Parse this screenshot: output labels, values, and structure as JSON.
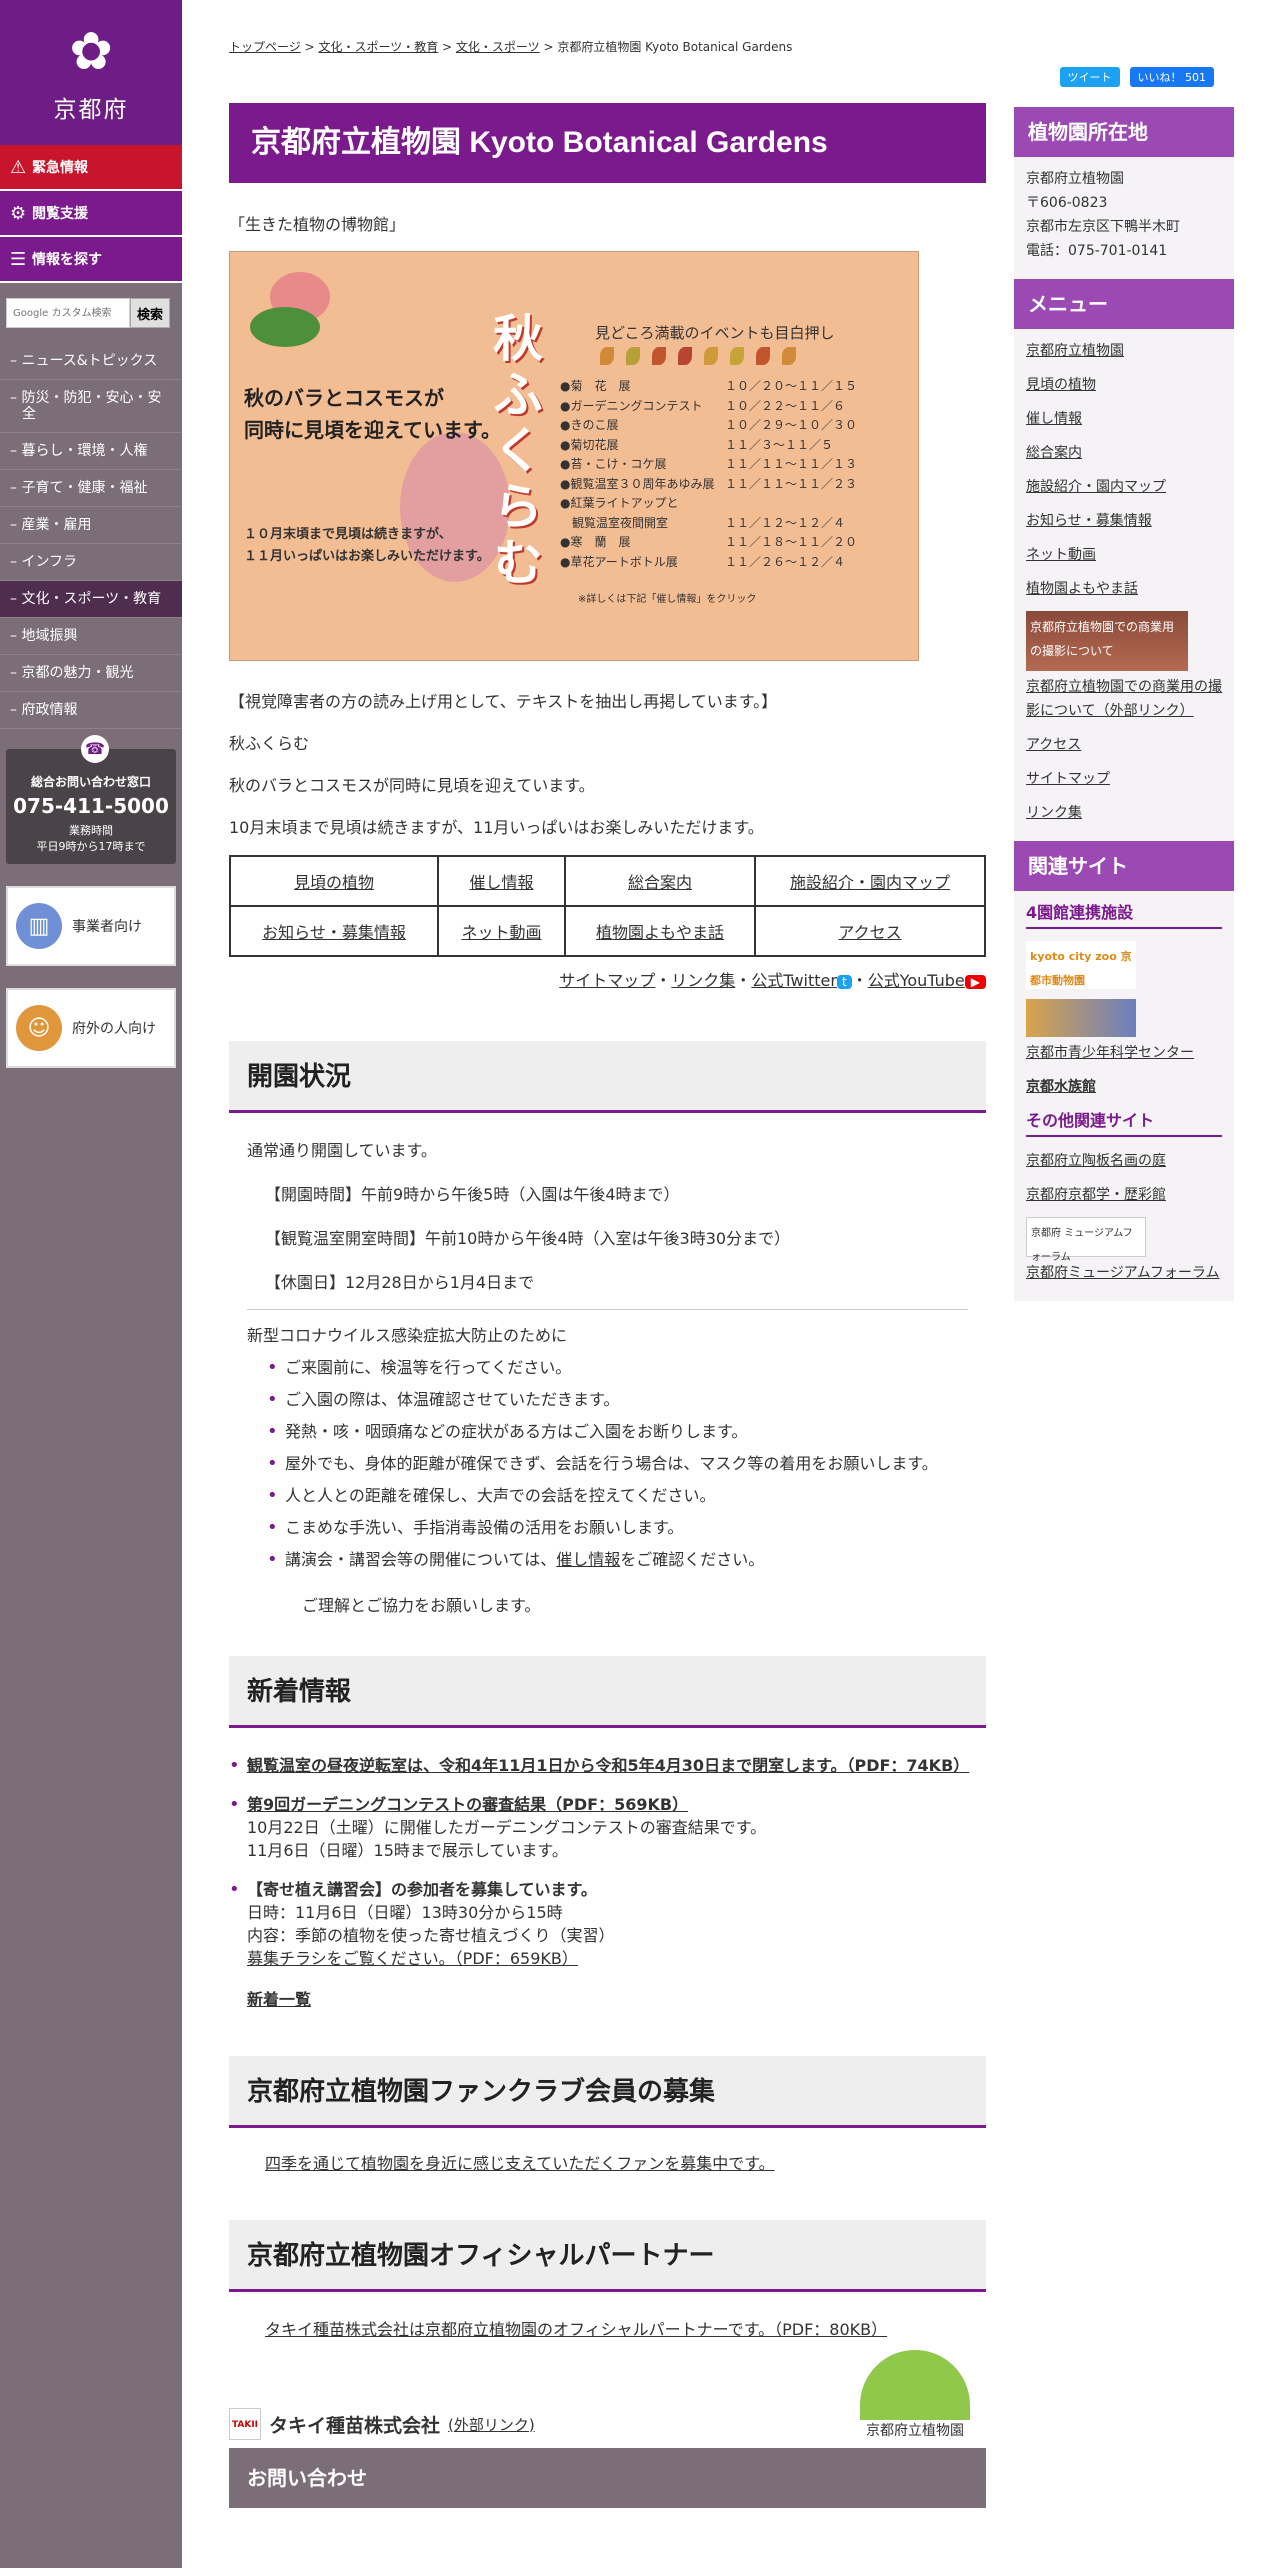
{
  "sidebar": {
    "logo_text": "京都府",
    "emergency": "緊急情報",
    "accessibility": "閲覧支援",
    "find": "情報を探す",
    "search_placeholder": "Google カスタム検索",
    "search_button": "検索",
    "nav": [
      "ニュース&トピックス",
      "防災・防犯・安心・安全",
      "暮らし・環境・人権",
      "子育て・健康・福祉",
      "産業・雇用",
      "インフラ",
      "文化・スポーツ・教育",
      "地域振興",
      "京都の魅力・観光",
      "府政情報"
    ],
    "contact_title": "総合お問い合わせ窓口",
    "contact_phone": "075-411-5000",
    "contact_hours": "業務時間",
    "contact_hours2": "平日9時から17時まで",
    "business": "事業者向け",
    "outside": "府外の人向け"
  },
  "breadcrumb": [
    "トップページ",
    "文化・スポーツ・教育",
    "文化・スポーツ",
    "京都府立植物園 Kyoto Botanical Gardens"
  ],
  "social": {
    "tweet": "ツイート",
    "like": "いいね！ 501"
  },
  "page_title": "京都府立植物園 Kyoto Botanical Gardens",
  "intro": "「生きた植物の博物館」",
  "banner": {
    "main": "秋ふくらむ",
    "left1": "秋のバラとコスモスが",
    "left2": "同時に見頃を迎えています。",
    "small1": "１０月末頃まで見頃は続きますが、",
    "small2": "１１月いっぱいはお楽しみいただけます。",
    "events_title": "見どころ満載のイベントも目白押し",
    "events": [
      {
        "name": "●菊　花　展",
        "date": "１０／２０〜１１／１５"
      },
      {
        "name": "●ガーデニングコンテスト",
        "date": "１０／２２〜１１／６"
      },
      {
        "name": "●きのこ展",
        "date": "１０／２９〜１０／３０"
      },
      {
        "name": "●菊切花展",
        "date": "１１／３〜１１／５"
      },
      {
        "name": "●苔・こけ・コケ展",
        "date": "１１／１１〜１１／１３"
      },
      {
        "name": "●観覧温室３０周年あゆみ展",
        "date": "１１／１１〜１１／２３"
      },
      {
        "name": "●紅葉ライトアップと",
        "date": ""
      },
      {
        "name": "　観覧温室夜間開室",
        "date": "１１／１２〜１２／４"
      },
      {
        "name": "●寒　蘭　展",
        "date": "１１／１８〜１１／２０"
      },
      {
        "name": "●草花アートボトル展",
        "date": "１１／２６〜１２／４"
      }
    ],
    "footnote": "※詳しくは下記「催し情報」をクリック"
  },
  "reader": {
    "note": "【視覚障害者の方の読み上げ用として、テキストを抽出し再掲しています。】",
    "l1": "秋ふくらむ",
    "l2": "秋のバラとコスモスが同時に見頃を迎えています。",
    "l3": "10月末頃まで見頃は続きますが、11月いっぱいはお楽しみいただけます。"
  },
  "links": [
    [
      "見頃の植物",
      "催し情報",
      "総合案内",
      "施設紹介・園内マップ"
    ],
    [
      "お知らせ・募集情報",
      "ネット動画",
      "植物園よもやま話",
      "アクセス"
    ]
  ],
  "sublinks": {
    "sitemap": "サイトマップ",
    "links": "リンク集",
    "twitter": "公式Twitter",
    "youtube": "公式YouTube"
  },
  "status": {
    "title": "開園状況",
    "normal": "通常通り開園しています。",
    "hours": "【開園時間】午前9時から午後5時（入園は午後4時まで）",
    "greenhouse": "【観覧温室開室時間】午前10時から午後4時（入室は午後3時30分まで）",
    "closed": "【休園日】12月28日から1月4日まで",
    "covid_title": "新型コロナウイルス感染症拡大防止のために",
    "covid": [
      "ご来園前に、検温等を行ってください。",
      "ご入園の際は、体温確認させていただきます。",
      "発熱・咳・咽頭痛などの症状がある方はご入園をお断りします。",
      "屋外でも、身体的距離が確保できず、会話を行う場合は、マスク等の着用をお願いします。",
      "人と人との距離を確保し、大声での会話を控えてください。",
      "こまめな手洗い、手指消毒設備の活用をお願いします。"
    ],
    "covid_last_pre": "講演会・講習会等の開催については、",
    "covid_last_link": "催し情報",
    "covid_last_post": "をご確認ください。",
    "thanks": "ご理解とご協力をお願いします。"
  },
  "news": {
    "title": "新着情報",
    "n1": "観覧温室の昼夜逆転室は、令和4年11月1日から令和5年4月30日まで閉室します。（PDF：74KB）",
    "n2": "第9回ガーデニングコンテストの審査結果（PDF：569KB）",
    "n2a": "10月22日（土曜）に開催したガーデニングコンテストの審査結果です。",
    "n2b": "11月6日（日曜）15時まで展示しています。",
    "n3": "【寄せ植え講習会】の参加者を募集しています。",
    "n3a": "日時：11月6日（日曜）13時30分から15時",
    "n3b": "内容：季節の植物を使った寄せ植えづくり（実習）",
    "n3c": "募集チラシをご覧ください。（PDF：659KB）",
    "more": "新着一覧"
  },
  "fanclub": {
    "title": "京都府立植物園ファンクラブ会員の募集",
    "text": "四季を通じて植物園を身近に感じ支えていただくファンを募集中です。"
  },
  "partner": {
    "title": "京都府立植物園オフィシャルパートナー",
    "text": "タキイ種苗株式会社は京都府立植物園のオフィシャルパートナーです。（PDF：80KB）",
    "company": "タキイ種苗株式会社",
    "ext": "(外部リンク)",
    "logo_text": "京都府立植物園"
  },
  "inquiry": "お問い合わせ",
  "right": {
    "location_title": "植物園所在地",
    "location": [
      "京都府立植物園",
      "〒606-0823",
      "京都市左京区下鴨半木町",
      "電話：075-701-0141"
    ],
    "menu_title": "メニュー",
    "menu": [
      "京都府立植物園",
      "見頃の植物",
      "催し情報",
      "総合案内",
      "施設紹介・園内マップ",
      "お知らせ・募集情報",
      "ネット動画",
      "植物園よもやま話"
    ],
    "thumb_text": "京都府立植物園での商業用の撮影について",
    "menu2": [
      "京都府立植物園での商業用の撮影について（外部リンク）",
      "アクセス",
      "サイトマップ",
      "リンク集"
    ],
    "related_title": "関連サイト",
    "sub1": "4園館連携施設",
    "zoo": "kyoto city zoo 京都市動物園",
    "rel1": [
      "京都市青少年科学センター",
      "京都水族館"
    ],
    "sub2": "その他関連サイト",
    "rel2": [
      "京都府立陶板名画の庭",
      "京都府京都学・歴彩館"
    ],
    "museum_logo": "京都府 ミュージアムフォーラム",
    "rel3": "京都府ミュージアムフォーラム"
  }
}
